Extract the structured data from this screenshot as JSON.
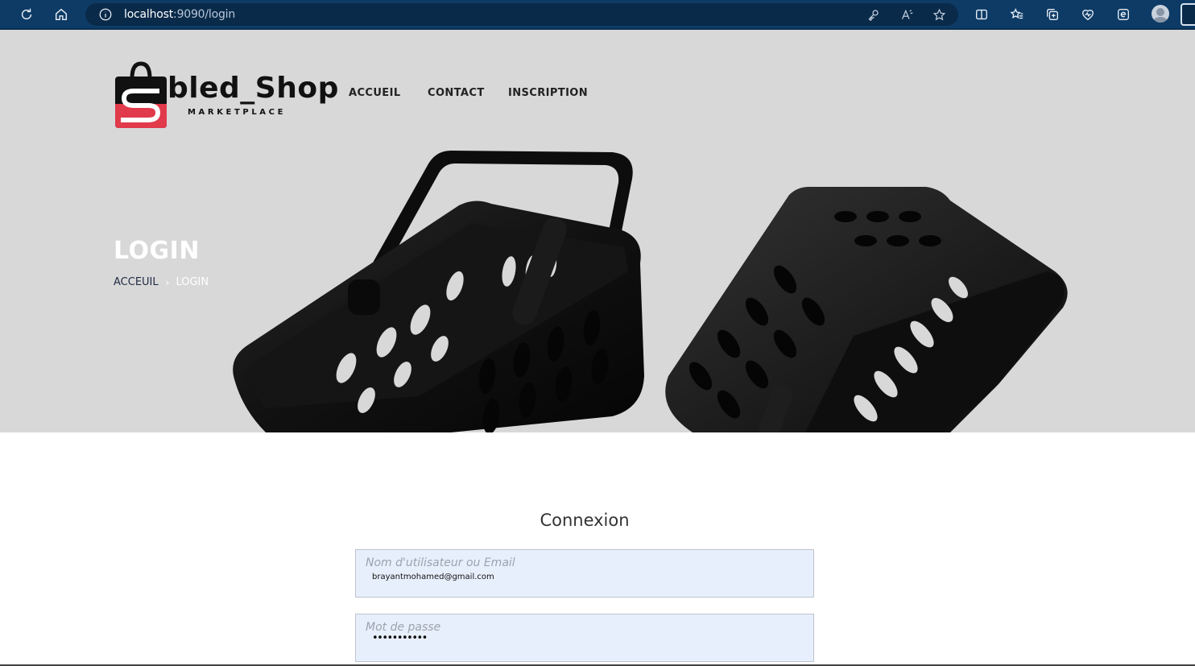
{
  "browser": {
    "url_host": "localhost",
    "url_rest": ":9090/login"
  },
  "brand": {
    "name": "bled_Shop",
    "tagline": "MARKETPLACE",
    "accent": "#e03a4b"
  },
  "nav": {
    "items": [
      {
        "label": "ACCUEIL"
      },
      {
        "label": "CONTACT"
      },
      {
        "label": "INSCRIPTION"
      }
    ]
  },
  "hero": {
    "title": "LOGIN",
    "breadcrumb_home": "ACCEUIL",
    "breadcrumb_sep": "›",
    "breadcrumb_current": "LOGIN",
    "background": "#d8d8d8"
  },
  "login": {
    "title": "Connexion",
    "username_placeholder": "Nom d'utilisateur ou Email",
    "username_value": "brayantmohamed@gmail.com",
    "password_placeholder": "Mot de passe",
    "password_value": "•••••••••••"
  }
}
